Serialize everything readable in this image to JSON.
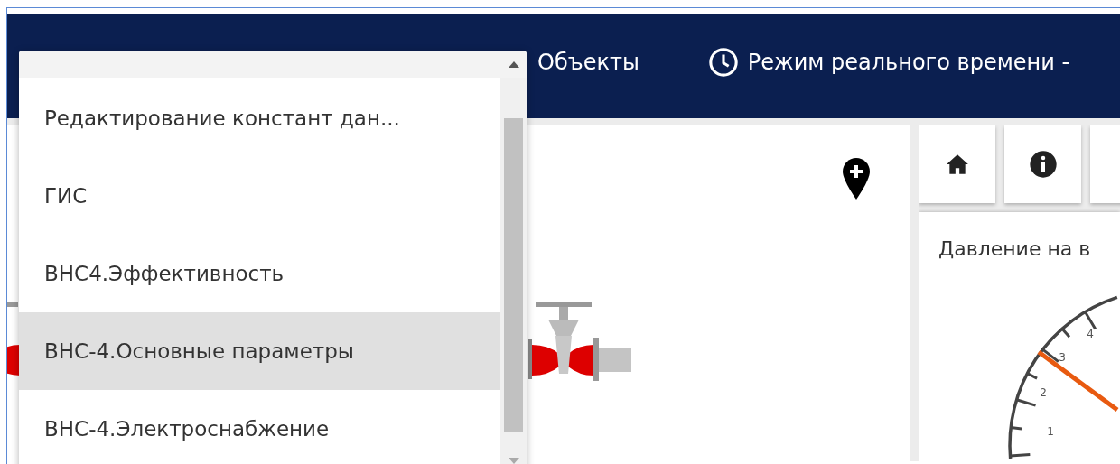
{
  "header": {
    "nav": [
      {
        "kind": "link",
        "label": "Объекты"
      },
      {
        "kind": "clock",
        "label": "Режим реального времени -"
      }
    ]
  },
  "dropdown": {
    "expanded": true,
    "items": [
      {
        "label": "Редактирование констант дан...",
        "selected": false
      },
      {
        "label": "ГИС",
        "selected": false
      },
      {
        "label": "ВНС4.Эффективность",
        "selected": false
      },
      {
        "label": "ВНС-4.Основные параметры",
        "selected": true
      },
      {
        "label": "ВНС-4.Электроснабжение",
        "selected": false
      }
    ]
  },
  "toolbar": [
    {
      "kind": "home"
    },
    {
      "kind": "info"
    },
    {
      "kind": "other"
    }
  ],
  "card": {
    "title": "Давление на в",
    "gauge": {
      "tick_labels": [
        "1",
        "2",
        "3",
        "4"
      ]
    }
  }
}
